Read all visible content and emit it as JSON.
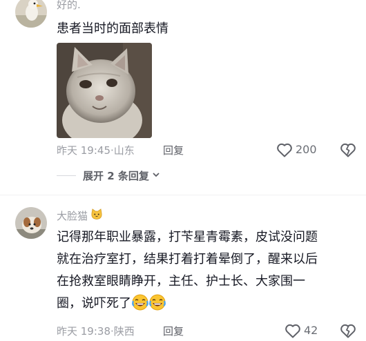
{
  "comments": [
    {
      "username": "好的.",
      "text": "患者当时的面部表情",
      "time": "昨天 19:45",
      "location": "山东",
      "reply_label": "回复",
      "like_count": "200",
      "expand_label": "展开 2 条回复"
    },
    {
      "username": "大脸猫",
      "text_lines": [
        "记得那年职业暴露，打苄星青霉素，皮试没问题",
        "就在治疗室打，结果打着打着晕倒了，醒来以后",
        "在抢救室眼睛睁开，主任、护士长、大家围一",
        "圈，说吓死了"
      ],
      "time": "昨天 19:38",
      "location": "陕西",
      "reply_label": "回复",
      "like_count": "42"
    }
  ],
  "icons": {
    "like": "heart-outline-icon",
    "dislike": "broken-heart-icon",
    "expand": "chevron-down-icon",
    "username_badge": "cat-face-icon",
    "emoji": "rolling-laughing-emoji"
  }
}
